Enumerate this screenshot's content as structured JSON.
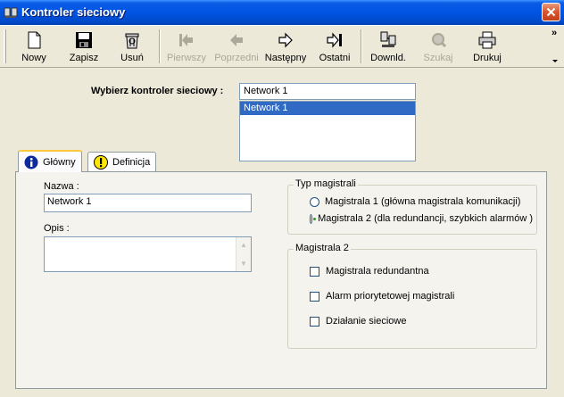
{
  "window": {
    "title": "Kontroler sieciowy"
  },
  "toolbar": {
    "buttons": [
      {
        "label": "Nowy",
        "icon": "new-document-icon",
        "enabled": true
      },
      {
        "label": "Zapisz",
        "icon": "floppy-disk-icon",
        "enabled": true
      },
      {
        "label": "Usuń",
        "icon": "trash-can-icon",
        "enabled": true
      },
      {
        "label": "Pierwszy",
        "icon": "first-arrow-icon",
        "enabled": false
      },
      {
        "label": "Poprzedni",
        "icon": "previous-arrow-icon",
        "enabled": false
      },
      {
        "label": "Następny",
        "icon": "next-arrow-icon",
        "enabled": true
      },
      {
        "label": "Ostatni",
        "icon": "last-arrow-icon",
        "enabled": true
      },
      {
        "label": "Downld.",
        "icon": "download-icon",
        "enabled": true
      },
      {
        "label": "Szukaj",
        "icon": "search-icon",
        "enabled": false
      },
      {
        "label": "Drukuj",
        "icon": "printer-icon",
        "enabled": true
      }
    ],
    "more": "»"
  },
  "selector": {
    "label": "Wybierz kontroler sieciowy :",
    "value": "Network 1",
    "options": [
      "Network 1"
    ]
  },
  "tabs": [
    {
      "label": "Główny",
      "icon": "info-icon",
      "active": true
    },
    {
      "label": "Definicja",
      "icon": "warning-icon",
      "active": false
    }
  ],
  "general": {
    "name_label": "Nazwa :",
    "name_value": "Network 1",
    "desc_label": "Opis :",
    "desc_value": ""
  },
  "bus_type": {
    "legend": "Typ magistrali",
    "options": [
      {
        "label": "Magistrala 1 (główna magistrala komunikacji)",
        "selected": false
      },
      {
        "label": "Magistrala 2 (dla redundancji, szybkich alarmów )",
        "selected": true
      }
    ]
  },
  "bus2": {
    "legend": "Magistrala 2",
    "options": [
      {
        "label": "Magistrala redundantna",
        "checked": false
      },
      {
        "label": "Alarm priorytetowej magistrali",
        "checked": false
      },
      {
        "label": "Działanie sieciowe",
        "checked": false
      }
    ]
  }
}
